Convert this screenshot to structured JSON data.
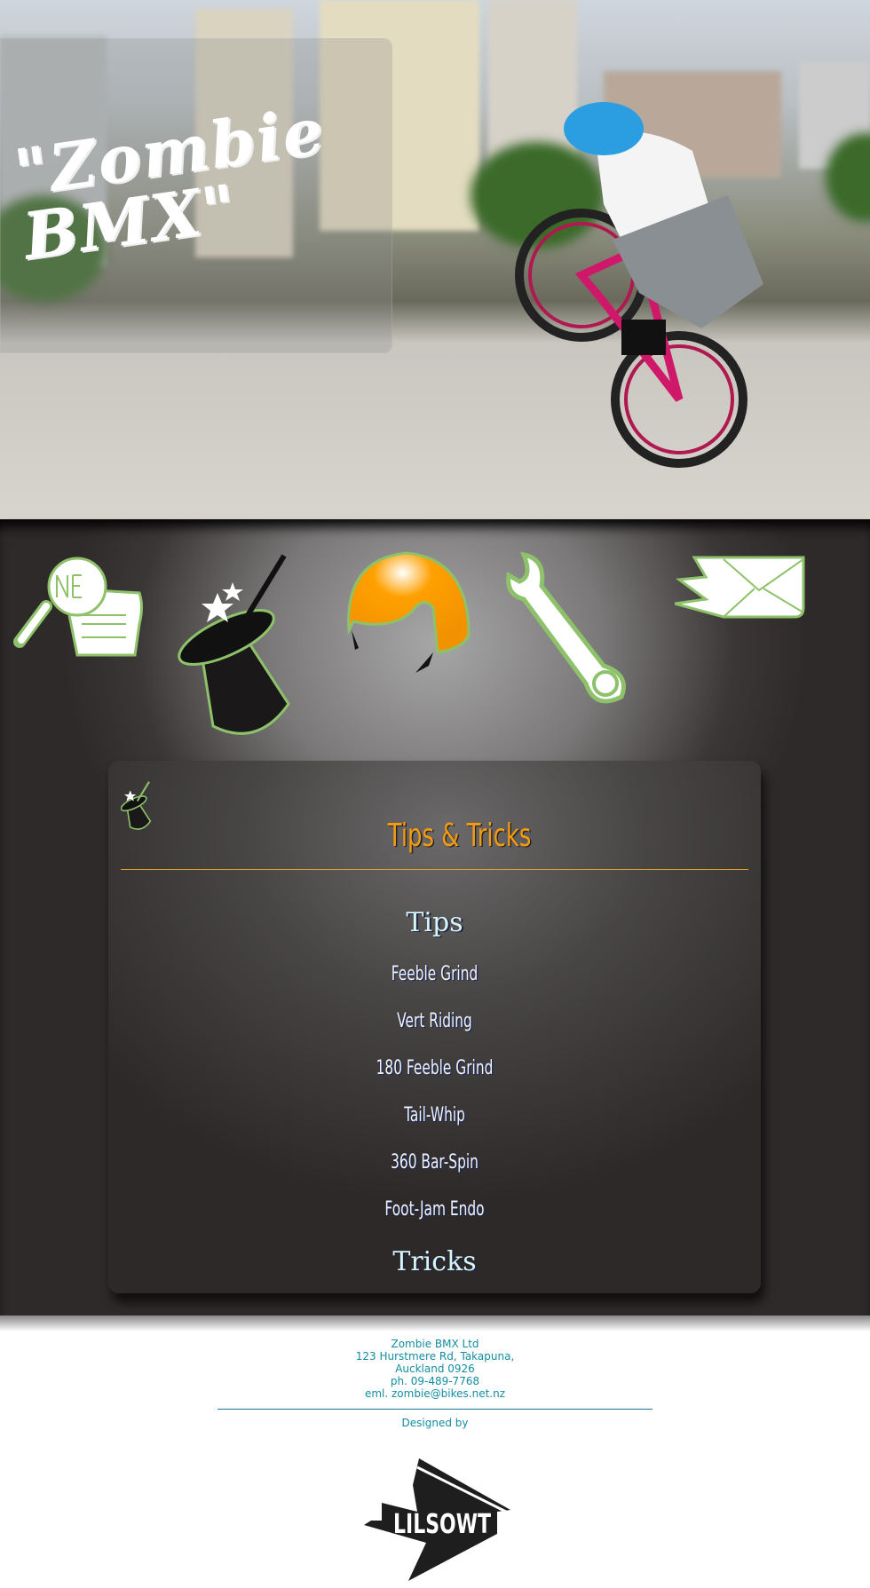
{
  "header": {
    "logo_text": "\"Zombie BMX\""
  },
  "nav": {
    "items": [
      {
        "name": "news",
        "icon": "newspaper-magnifier-icon"
      },
      {
        "name": "tips-tricks",
        "icon": "magic-hat-icon"
      },
      {
        "name": "gear",
        "icon": "helmet-icon"
      },
      {
        "name": "repairs",
        "icon": "wrench-icon"
      },
      {
        "name": "contact",
        "icon": "envelope-icon"
      }
    ]
  },
  "colors": {
    "accent_orange": "#f39a12",
    "icon_green": "#8dc26a",
    "footer_teal": "#138da0"
  },
  "panel": {
    "title": "Tips & Tricks",
    "tips_heading": "Tips",
    "tips": [
      "Feeble Grind",
      "Vert Riding",
      "180 Feeble Grind",
      "Tail-Whip",
      "360 Bar-Spin",
      "Foot-Jam Endo"
    ],
    "tricks_heading": "Tricks"
  },
  "footer": {
    "company": "Zombie BMX Ltd",
    "address1": "123 Hurstmere Rd, Takapuna,",
    "address2": "Auckland 0926",
    "phone": "ph. 09-489-7768",
    "email": "eml. zombie@bikes.net.nz",
    "designed_by": "Designed by",
    "designer_logo_text": "LILSOWT"
  }
}
